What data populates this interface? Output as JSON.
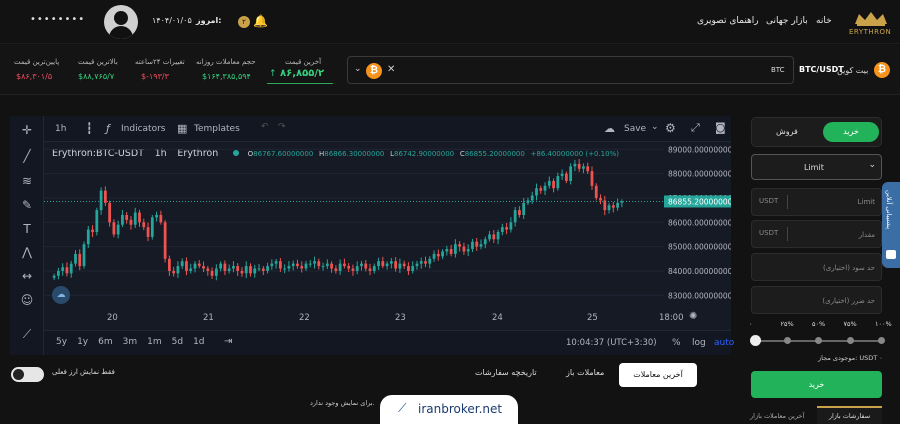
{
  "nav": {
    "brand": "ERYTHRON",
    "home": "خانه",
    "global_market": "بازار جهانی",
    "visual_guide": "راهنمای تصویری"
  },
  "header": {
    "username_mask": "••••••••",
    "date_label": "امروز:",
    "date_value": "۱۴۰۴/۰۱/۰۵",
    "notification_count": "۲"
  },
  "ticker": {
    "pair": "BTC/USDT",
    "pair_fa": "بیت کوین",
    "search_value": "BTC",
    "last_price_label": "آخرین قیمت",
    "last_price": "۸۶,۸۵۵/۲",
    "daily_volume_label": "حجم معاملات روزانه",
    "daily_volume": "$۱۶۴,۳۸۵,۵۹۴",
    "change_label": "تغییرات ۲۴ساعته",
    "change": "$-۱۹۳/۳",
    "high_label": "بالاترین قیمت",
    "high": "$۸۸,۷۶۵/۷",
    "low_label": "پایین‌ترین قیمت",
    "low": "$۸۶,۳۰۱/۵"
  },
  "chart_toolbar": {
    "interval": "1h",
    "indicators": "Indicators",
    "templates": "Templates",
    "save": "Save"
  },
  "chart_legend": {
    "symbol": "Erythron:BTC-USDT",
    "interval": "1h",
    "source": "Erythron",
    "o_label": "O",
    "o": "86767.60000000",
    "h_label": "H",
    "h": "86866.30000000",
    "l_label": "L",
    "l": "86742.90000000",
    "c_label": "C",
    "c": "86855.20000000",
    "chg": "+86.40000000 (+0.10%)"
  },
  "chart_bottom": {
    "ranges": [
      "5y",
      "1y",
      "6m",
      "3m",
      "1m",
      "5d",
      "1d"
    ],
    "clock": "10:04:37 (UTC+3:30)",
    "pct": "%",
    "log": "log",
    "auto": "auto"
  },
  "chart_data": {
    "type": "candlestick",
    "x_ticks": [
      "20",
      "21",
      "22",
      "23",
      "24",
      "25",
      "18:00"
    ],
    "y_ticks": [
      "89000.00000000",
      "88000.00000000",
      "87000.00000000",
      "86000.00000000",
      "85000.00000000",
      "84000.00000000",
      "83000.00000000"
    ],
    "ylim": [
      82600,
      89300
    ],
    "last_price_tag": "86855.20000000",
    "closes": [
      83800,
      84000,
      84150,
      83900,
      84300,
      84700,
      84200,
      85100,
      85700,
      85600,
      86500,
      87300,
      86800,
      86000,
      85500,
      85900,
      86300,
      86100,
      85900,
      86400,
      86000,
      85800,
      85400,
      86200,
      86300,
      86000,
      84500,
      84000,
      83900,
      84200,
      84400,
      84000,
      84100,
      84300,
      84200,
      84100,
      84000,
      83800,
      84100,
      84300,
      84000,
      84100,
      84200,
      84000,
      83900,
      84200,
      83900,
      84100,
      84100,
      84000,
      84200,
      84300,
      84400,
      84100,
      84100,
      84200,
      84300,
      84200,
      84100,
      84300,
      84300,
      84400,
      84200,
      84200,
      84300,
      84100,
      84000,
      84300,
      84200,
      84100,
      84000,
      84200,
      84300,
      84100,
      84000,
      84200,
      84400,
      84200,
      84300,
      84400,
      84100,
      84300,
      84200,
      84000,
      84200,
      84300,
      84400,
      84300,
      84500,
      84700,
      84600,
      84800,
      84900,
      84700,
      85100,
      85000,
      84800,
      84900,
      85200,
      85000,
      85100,
      85300,
      85500,
      85300,
      85600,
      85800,
      85700,
      86000,
      86500,
      86300,
      86800,
      86900,
      87100,
      87400,
      87300,
      87500,
      87700,
      87400,
      87900,
      88000,
      87700,
      88300,
      88400,
      88200,
      88300,
      88100,
      87500,
      87000,
      86900,
      86500,
      86700,
      86600,
      86800,
      86855
    ]
  },
  "panel": {
    "buy_tab": "خرید",
    "sell_tab": "فروش",
    "order_type": "Limit",
    "limit_label": "Limit",
    "currency": "USDT",
    "amount_label": "مقدار",
    "tp_placeholder": "حد سود (اختیاری)",
    "sl_placeholder": "حد ضرر (اختیاری)",
    "slider_marks": [
      "۰",
      "۲۵%",
      "۵۰%",
      "۷۵%",
      "۱۰۰%"
    ],
    "balance_label": "موجودی مجاز: USDT ۰",
    "buy_button": "خرید",
    "market_orders": "سفارشات بازار",
    "last_trades": "آخرین معاملات بازار",
    "side_tab": "پشتیبانی آنلاین"
  },
  "bottom": {
    "tab_last_trades": "آخرین معاملات",
    "tab_open": "معاملات باز",
    "tab_history": "تاریخچه سفارشات",
    "toggle_label": "فقط نمایش ارز فعلی",
    "empty_msg": "برای نمایش وجود ندارد.",
    "watermark": "iranbroker.net"
  },
  "colors": {
    "up": "#26a69a",
    "down": "#ef5350",
    "accent_green": "#22b35a",
    "positive": "#35d07f",
    "negative": "#ef4e5f",
    "price_tag": "#26a69a"
  }
}
